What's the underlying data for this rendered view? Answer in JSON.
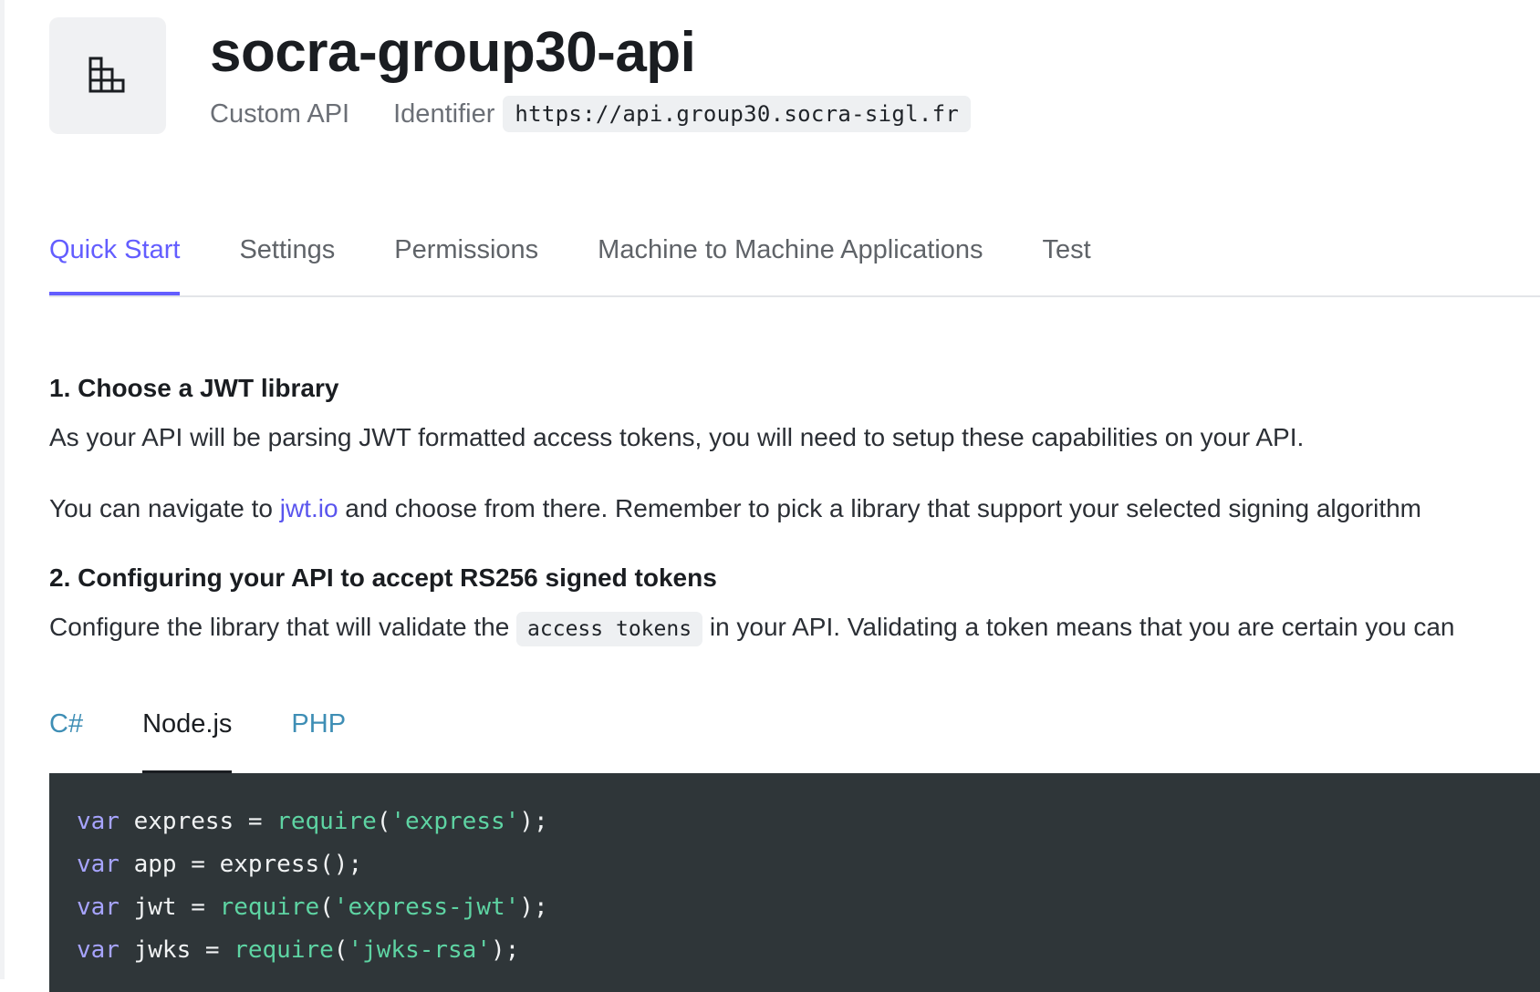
{
  "api": {
    "name": "socra-group30-api",
    "type": "Custom API",
    "identifier_label": "Identifier",
    "identifier_value": "https://api.group30.socra-sigl.fr"
  },
  "tabs": [
    {
      "label": "Quick Start",
      "active": true
    },
    {
      "label": "Settings",
      "active": false
    },
    {
      "label": "Permissions",
      "active": false
    },
    {
      "label": "Machine to Machine Applications",
      "active": false
    },
    {
      "label": "Test",
      "active": false
    }
  ],
  "quickstart": {
    "step1_heading": "1. Choose a JWT library",
    "step1_p1": "As your API will be parsing JWT formatted access tokens, you will need to setup these capabilities on your API.",
    "step1_p2_before": "You can navigate to ",
    "step1_p2_link": "jwt.io",
    "step1_p2_after": " and choose from there. Remember to pick a library that support your selected signing algorithm",
    "step2_heading": "2. Configuring your API to accept RS256 signed tokens",
    "step2_p_before": "Configure the library that will validate the ",
    "step2_p_code": "access tokens",
    "step2_p_after": " in your API. Validating a token means that you are certain you can"
  },
  "lang_tabs": [
    {
      "label": "C#",
      "active": false
    },
    {
      "label": "Node.js",
      "active": true
    },
    {
      "label": "PHP",
      "active": false
    }
  ],
  "code": {
    "keyword": "var",
    "lines": [
      {
        "name": "express",
        "op": " = ",
        "fn": "require",
        "open": "(",
        "str": "'express'",
        "close": ");"
      },
      {
        "name": "app",
        "op": " = ",
        "call": "express();"
      },
      {
        "name": "jwt",
        "op": " = ",
        "fn": "require",
        "open": "(",
        "str": "'express-jwt'",
        "close": ");"
      },
      {
        "name": "jwks",
        "op": " = ",
        "fn": "require",
        "open": "(",
        "str": "'jwks-rsa'",
        "close": ");"
      }
    ]
  },
  "colors": {
    "accent": "#635dff",
    "link": "#5a55ee",
    "code_bg": "#2f3639",
    "code_keyword": "#a7a4ff",
    "code_string": "#5ed4a3"
  },
  "icons": {
    "api_logo": "building-blocks-icon"
  }
}
